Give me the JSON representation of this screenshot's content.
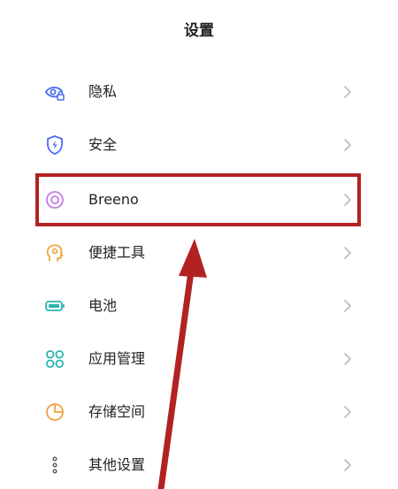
{
  "header": {
    "title": "设置"
  },
  "settings": {
    "items": [
      {
        "label": "隐私",
        "icon": "privacy-eye-lock-icon"
      },
      {
        "label": "安全",
        "icon": "security-shield-icon"
      },
      {
        "label": "Breeno",
        "icon": "breeno-circle-icon"
      },
      {
        "label": "便捷工具",
        "icon": "convenience-tools-icon"
      },
      {
        "label": "电池",
        "icon": "battery-icon"
      },
      {
        "label": "应用管理",
        "icon": "app-management-grid-icon"
      },
      {
        "label": "存储空间",
        "icon": "storage-pie-icon"
      },
      {
        "label": "其他设置",
        "icon": "other-settings-dots-icon"
      }
    ],
    "chevron_icon": "chevron-right-icon"
  },
  "annotation": {
    "highlighted_item": "Breeno",
    "highlight_color": "#b22222",
    "arrow_color": "#b22222"
  },
  "colors": {
    "icon_blue": "#4a6cf7",
    "icon_purple": "#c77be0",
    "icon_orange": "#f0a33a",
    "icon_teal": "#2bb5b0",
    "chevron": "#bbbbbb"
  }
}
